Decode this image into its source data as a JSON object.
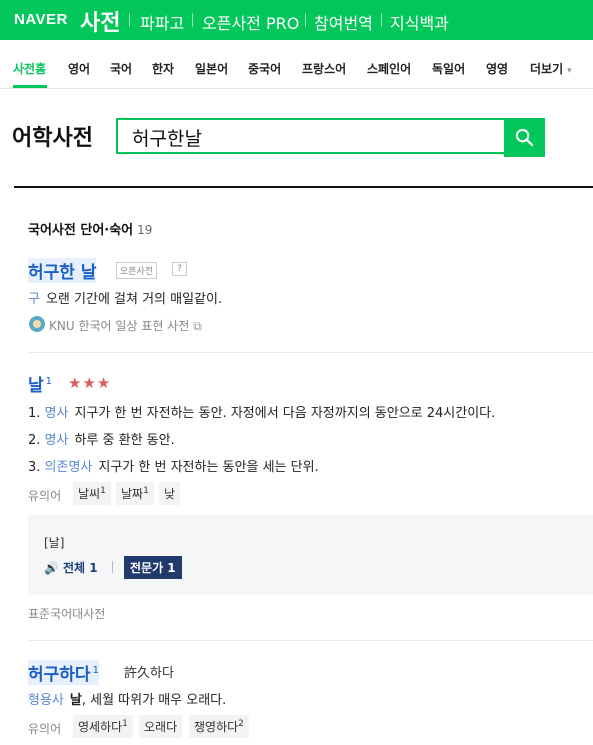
{
  "topbar": {
    "logo": "NAVER",
    "title": "사전",
    "nav": [
      "파파고",
      "오픈사전 PRO",
      "참여번역",
      "지식백과"
    ]
  },
  "tabs": [
    "사전홈",
    "영어",
    "국어",
    "한자",
    "일본어",
    "중국어",
    "프랑스어",
    "스페인어",
    "독일어",
    "영영",
    "더보기"
  ],
  "search": {
    "heading": "어학사전",
    "query": "허구한날"
  },
  "section": {
    "title": "국어사전 단어·숙어",
    "count": "19"
  },
  "entries": {
    "e1": {
      "headword": "허구한 날",
      "badge": "오픈사전",
      "badge2": "?",
      "pos": "구",
      "definition": "오랜 기간에 걸쳐 거의 매일같이.",
      "source": "KNU 한국어 일상 표현 사전"
    },
    "e2": {
      "headword": "날",
      "sup": "1",
      "stars": "★★★",
      "senses": [
        {
          "num": "1.",
          "pos": "명사",
          "text": "지구가 한 번 자전하는 동안. 자정에서 다음 자정까지의 동안으로 24시간이다."
        },
        {
          "num": "2.",
          "pos": "명사",
          "text": "하루 중 환한 동안."
        },
        {
          "num": "3.",
          "pos": "의존명사",
          "text": "지구가 한 번 자전하는 동안을 세는 단위."
        }
      ],
      "syn_label": "유의어",
      "syns": [
        {
          "word": "날씨",
          "sup": "1"
        },
        {
          "word": "날짜",
          "sup": "1"
        },
        {
          "word": "낮",
          "sup": ""
        }
      ],
      "pron_label": "[날]",
      "pron_all": "전체 1",
      "pron_expert": "전문가 1",
      "source": "표준국어대사전"
    },
    "e3": {
      "headword": "허구하다",
      "sup": "1",
      "hanja": "許久하다",
      "pos": "형용사",
      "bold": "날",
      "definition": ", 세월 따위가 매우 오래다.",
      "syn_label": "유의어",
      "syns": [
        {
          "word": "영세하다",
          "sup": "1"
        },
        {
          "word": "오래다",
          "sup": ""
        },
        {
          "word": "쟁영하다",
          "sup": "2"
        }
      ]
    }
  },
  "colors": {
    "brand": "#03c75a",
    "link": "#1a5fc2",
    "star": "#e05c5c"
  }
}
